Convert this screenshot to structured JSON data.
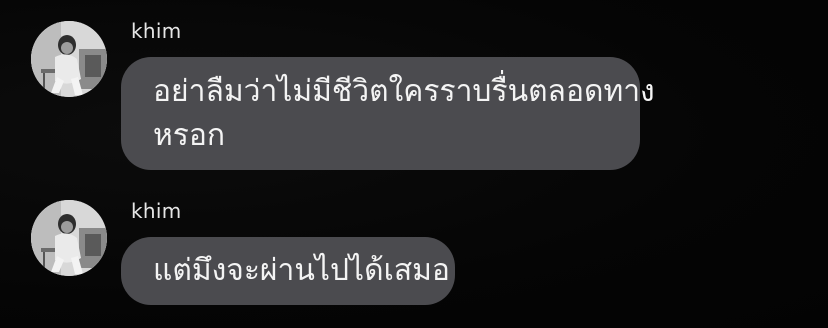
{
  "messages": [
    {
      "sender": "khim",
      "avatar": "profile-photo",
      "lines": [
        "อย่าลืมว่าไม่มีชีวิตใครราบรื่นตลอดทาง",
        "หรอก"
      ]
    },
    {
      "sender": "khim",
      "avatar": "profile-photo",
      "lines": [
        "แต่มึงจะผ่านไปได้เสมอ"
      ]
    }
  ],
  "colors": {
    "background": "#050505",
    "bubble": "#4b4b4f",
    "text": "#f4f4f4",
    "sender_name": "#e6e6e6"
  }
}
